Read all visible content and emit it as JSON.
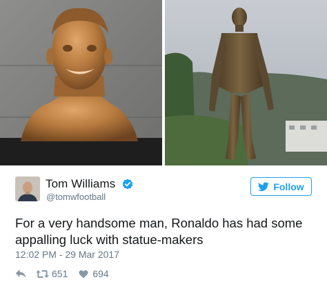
{
  "tweet": {
    "author_name": "Tom Williams",
    "author_handle": "@tomwfootball",
    "follow_label": "Follow",
    "text": "For a very handsome man, Ronaldo has had some appalling luck with statue-makers",
    "timestamp": "12:02 PM - 29 Mar 2017",
    "retweet_count": "651",
    "like_count": "694"
  },
  "icons": {
    "verified": "verified-badge-icon",
    "follow": "twitter-bird-icon",
    "reply": "reply-icon",
    "retweet": "retweet-icon",
    "like": "heart-icon"
  },
  "colors": {
    "accent": "#1da1f2",
    "muted": "#657786",
    "text": "#14171a",
    "action_icon": "#8899a6"
  }
}
